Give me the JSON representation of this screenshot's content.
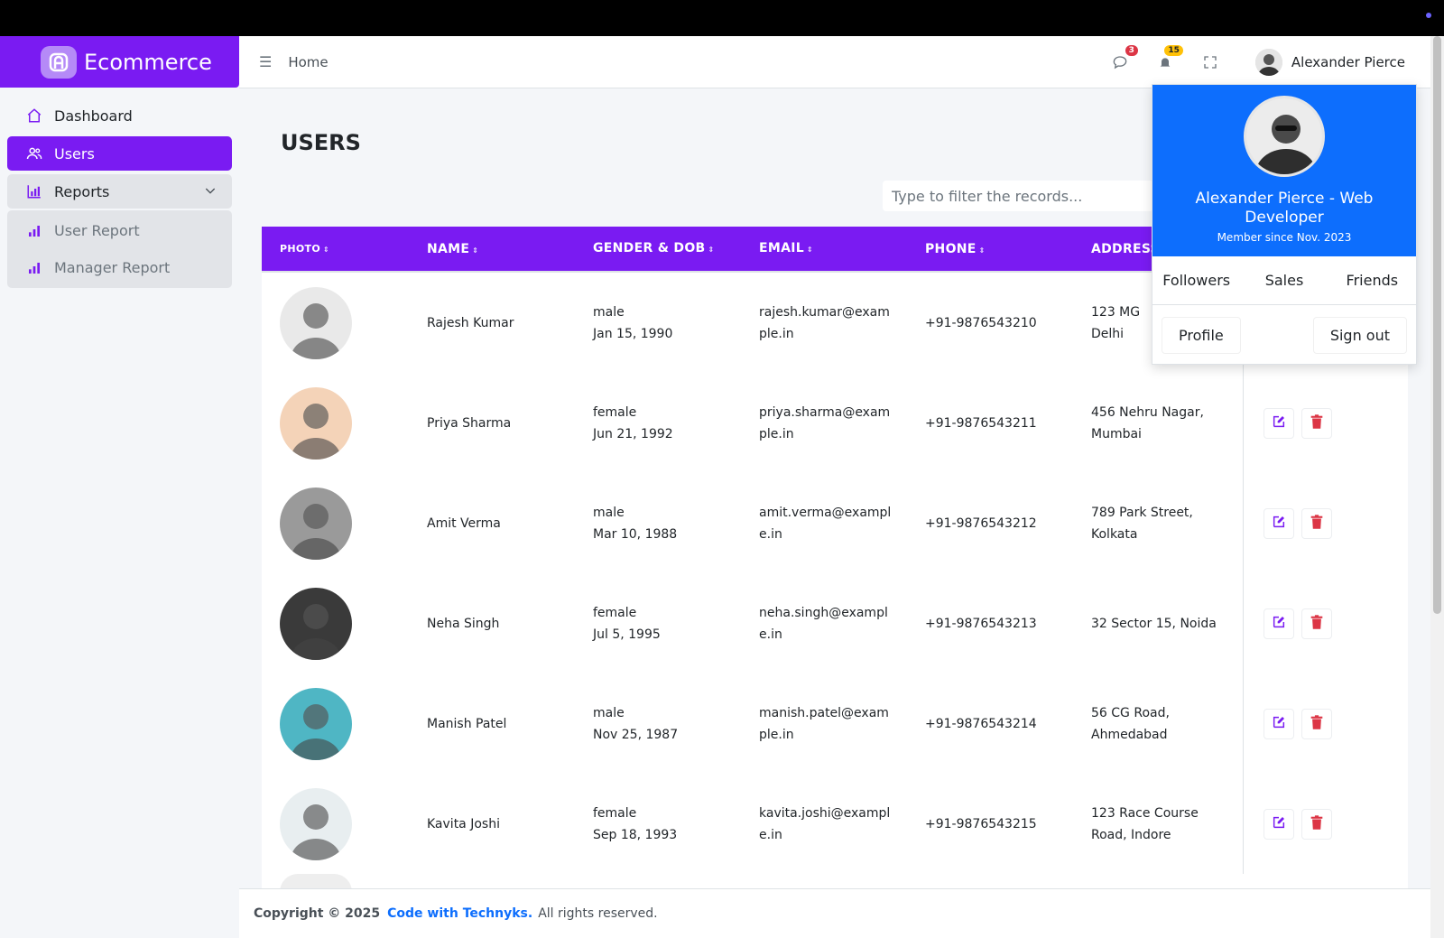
{
  "brand": {
    "title": "Ecommerce"
  },
  "sidebar": {
    "items": [
      {
        "label": "Dashboard",
        "icon": "home-icon"
      },
      {
        "label": "Users",
        "icon": "users-icon"
      },
      {
        "label": "Reports",
        "icon": "bar-chart-icon"
      }
    ],
    "submenu": [
      {
        "label": "User Report",
        "icon": "bar-chart-icon"
      },
      {
        "label": "Manager Report",
        "icon": "bar-chart-icon"
      }
    ]
  },
  "header": {
    "breadcrumb": "Home",
    "messages_badge": "3",
    "notifications_badge": "15",
    "user_name": "Alexander Pierce"
  },
  "page": {
    "title": "USERS",
    "filter_placeholder": "Type to filter the records..."
  },
  "table": {
    "columns": [
      "PHOTO",
      "NAME",
      "GENDER & DOB",
      "EMAIL",
      "PHONE",
      "ADDRESS"
    ],
    "rows": [
      {
        "name": "Rajesh Kumar",
        "gender": "male",
        "dob": "Jan 15, 1990",
        "email_1": "rajesh.kumar@exam",
        "email_2": "ple.in",
        "phone": "+91-9876543210",
        "addr_1": "123 MG",
        "addr_2": "Delhi",
        "photo_color": "#e9e9e9"
      },
      {
        "name": "Priya Sharma",
        "gender": "female",
        "dob": "Jun 21, 1992",
        "email_1": "priya.sharma@exam",
        "email_2": "ple.in",
        "phone": "+91-9876543211",
        "addr_1": "456 Nehru Nagar,",
        "addr_2": "Mumbai",
        "photo_color": "#f4d3b8"
      },
      {
        "name": "Amit Verma",
        "gender": "male",
        "dob": "Mar 10, 1988",
        "email_1": "amit.verma@exampl",
        "email_2": "e.in",
        "phone": "+91-9876543212",
        "addr_1": "789 Park Street,",
        "addr_2": "Kolkata",
        "photo_color": "#9a9a9a"
      },
      {
        "name": "Neha Singh",
        "gender": "female",
        "dob": "Jul 5, 1995",
        "email_1": "neha.singh@exampl",
        "email_2": "e.in",
        "phone": "+91-9876543213",
        "addr_1": "32 Sector 15, Noida",
        "addr_2": "",
        "photo_color": "#3a3a3a"
      },
      {
        "name": "Manish Patel",
        "gender": "male",
        "dob": "Nov 25, 1987",
        "email_1": "manish.patel@exam",
        "email_2": "ple.in",
        "phone": "+91-9876543214",
        "addr_1": "56 CG Road,",
        "addr_2": "Ahmedabad",
        "photo_color": "#4fb6c4"
      },
      {
        "name": "Kavita Joshi",
        "gender": "female",
        "dob": "Sep 18, 1993",
        "email_1": "kavita.joshi@exampl",
        "email_2": "e.in",
        "phone": "+91-9876543215",
        "addr_1": "123 Race Course",
        "addr_2": "Road, Indore",
        "photo_color": "#e8eef0"
      }
    ]
  },
  "footer": {
    "copyright": "Copyright © 2025",
    "link": "Code with Technyks.",
    "rights": "All rights reserved."
  },
  "dropdown": {
    "name": "Alexander Pierce - Web Developer",
    "since": "Member since Nov. 2023",
    "stats": [
      "Followers",
      "Sales",
      "Friends"
    ],
    "profile": "Profile",
    "signout": "Sign out"
  },
  "colors": {
    "accent": "#7a1bf2",
    "dropdown_header": "#0d6efd",
    "delete": "#dc3545"
  }
}
